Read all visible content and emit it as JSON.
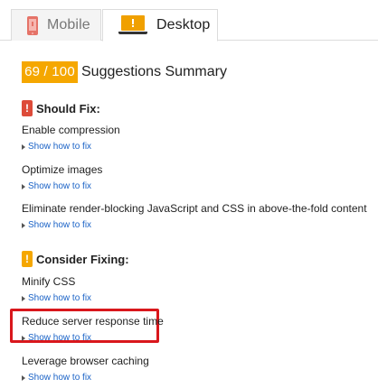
{
  "tabs": {
    "mobile": {
      "label": "Mobile",
      "icon": "mobile-phone-icon"
    },
    "desktop": {
      "label": "Desktop",
      "icon": "laptop-warning-icon",
      "active": true
    }
  },
  "summary": {
    "score": "69 / 100",
    "title": "Suggestions Summary",
    "score_color": "#f5a700"
  },
  "should_fix": {
    "title": "Should Fix:",
    "icon": "red-exclamation-icon",
    "color": "#dd4b39",
    "items": [
      {
        "title": "Enable compression",
        "link": "Show how to fix"
      },
      {
        "title": "Optimize images",
        "link": "Show how to fix"
      },
      {
        "title": "Eliminate render-blocking JavaScript and CSS in above-the-fold content",
        "link": "Show how to fix"
      }
    ]
  },
  "consider_fixing": {
    "title": "Consider Fixing:",
    "icon": "orange-exclamation-icon",
    "color": "#f5a700",
    "items": [
      {
        "title": "Minify CSS",
        "link": "Show how to fix"
      },
      {
        "title": "Reduce server response time",
        "link": "Show how to fix",
        "highlighted": true
      },
      {
        "title": "Leverage browser caching",
        "link": "Show how to fix"
      }
    ]
  },
  "colors": {
    "link": "#1a62c6",
    "highlight": "#d9171c"
  }
}
